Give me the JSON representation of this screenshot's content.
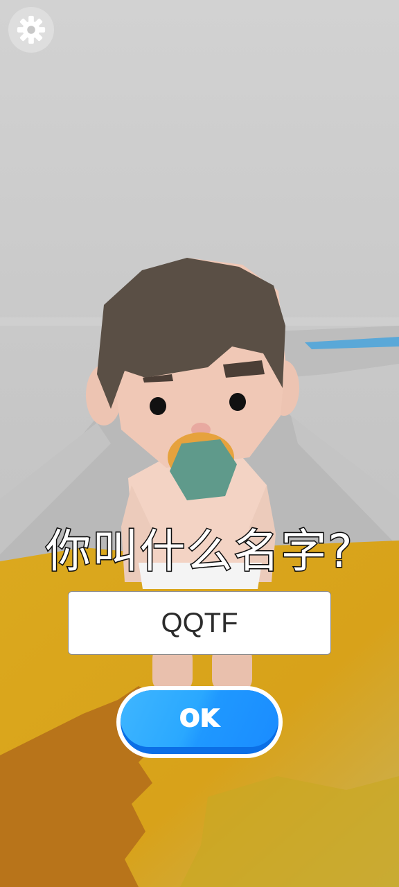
{
  "settings": {
    "icon": "gear-icon"
  },
  "dialog": {
    "question": "你叫什么名字?",
    "name_value": "QQTF",
    "ok_label": "OK"
  },
  "colors": {
    "background": "#d6d6d6",
    "floor_yellow": "#d9a91f",
    "ok_button": "#2aa8ff",
    "hair": "#5a4f45",
    "skin": "#f0cab7",
    "pacifier": "#5f9a8b"
  }
}
